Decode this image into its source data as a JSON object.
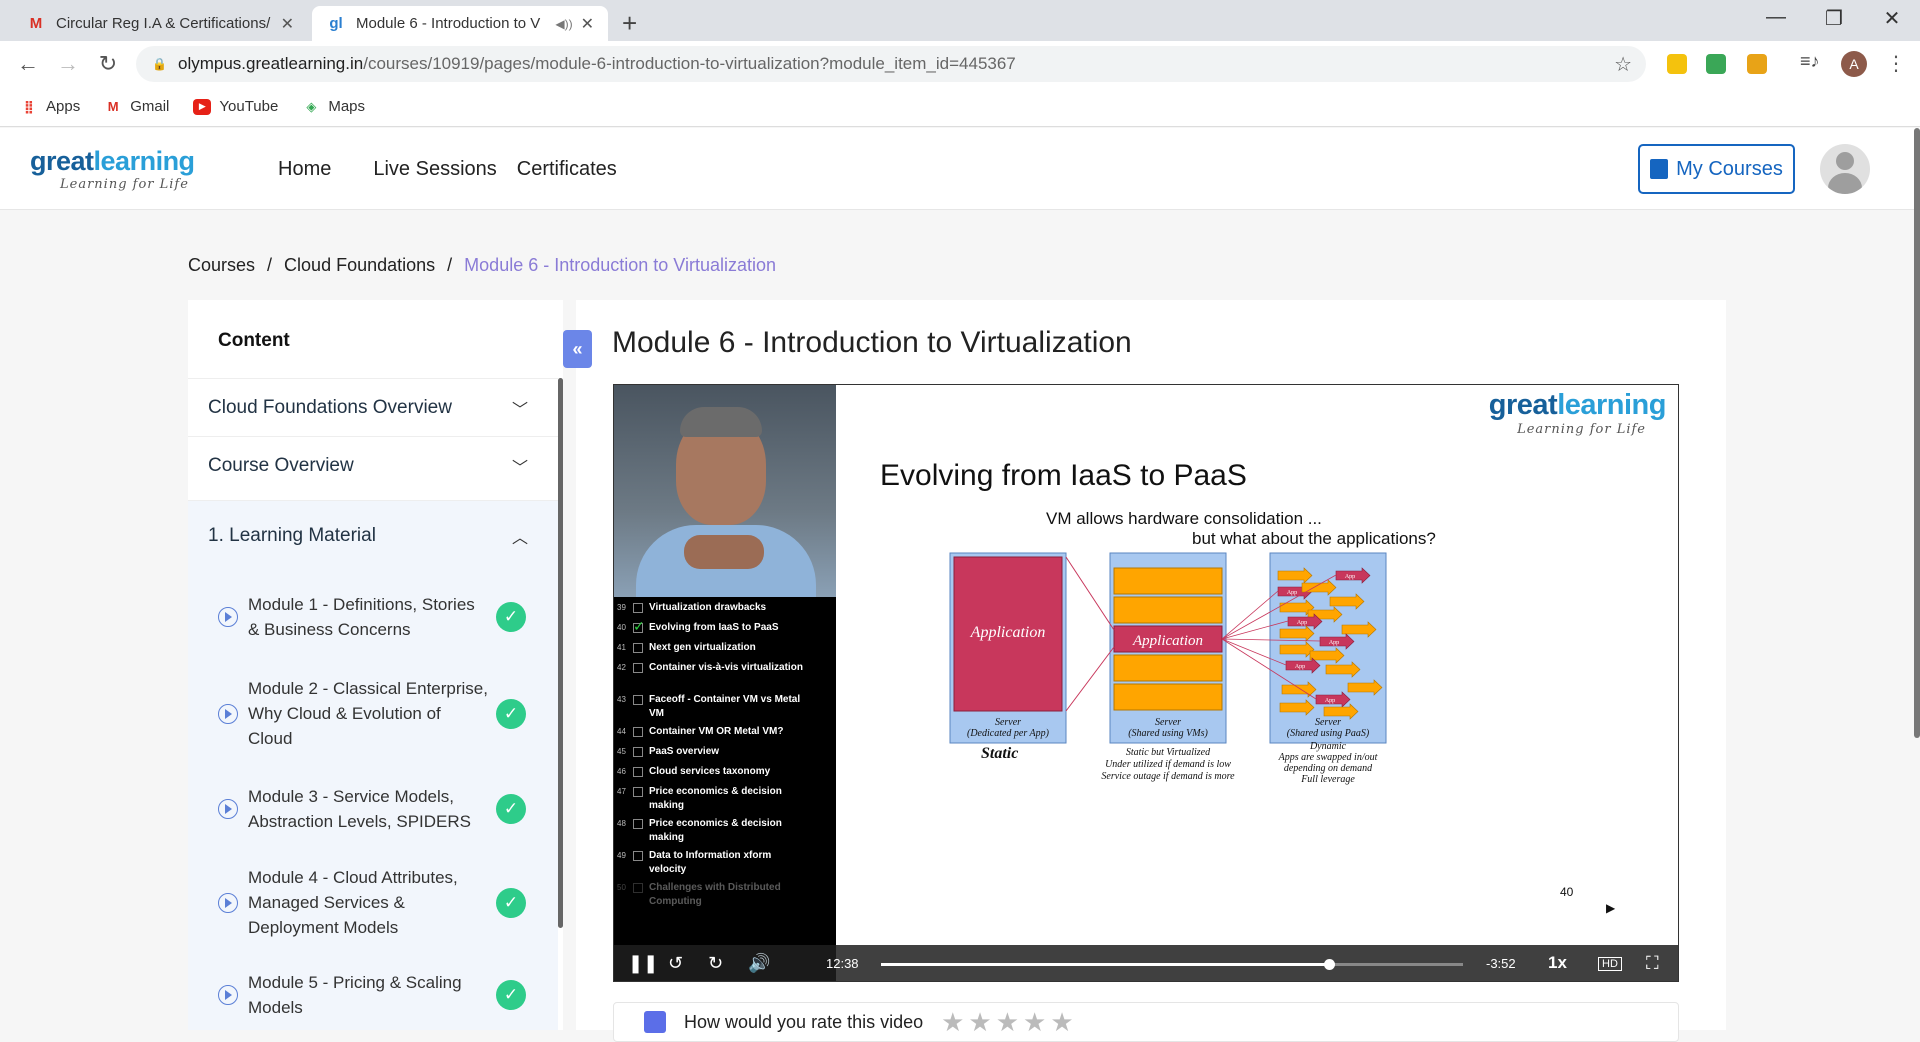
{
  "browser": {
    "tabs": [
      {
        "title": "Circular Reg I.A & Certifications/",
        "favicon": "gmail-icon"
      },
      {
        "title": "Module 6 - Introduction to V",
        "favicon": "greatlearning-icon"
      }
    ],
    "url_host": "olympus.greatlearning.in",
    "url_path": "/courses/10919/pages/module-6-introduction-to-virtualization?module_item_id=445367",
    "profile_initial": "A",
    "bookmarks": [
      {
        "label": "Apps",
        "icon": "apps-grid-icon"
      },
      {
        "label": "Gmail",
        "icon": "gmail-icon"
      },
      {
        "label": "YouTube",
        "icon": "youtube-icon"
      },
      {
        "label": "Maps",
        "icon": "maps-icon"
      }
    ]
  },
  "site": {
    "logo_brand_a": "great",
    "logo_brand_b": "learning",
    "logo_tagline": "Learning for Life",
    "nav": [
      "Home",
      "Live Sessions",
      "Certificates"
    ],
    "my_courses": "My Courses"
  },
  "breadcrumb": {
    "items": [
      "Courses",
      "Cloud Foundations"
    ],
    "separator": "/",
    "current": "Module 6 - Introduction to Virtualization"
  },
  "sidebar": {
    "heading": "Content",
    "sections": [
      {
        "label": "Cloud Foundations Overview",
        "expanded": false
      },
      {
        "label": "Course Overview",
        "expanded": false
      },
      {
        "label": "1. Learning Material",
        "expanded": true
      }
    ],
    "items": [
      {
        "label": "Module 1 - Definitions, Stories & Business Concerns",
        "completed": true
      },
      {
        "label": "Module 2 - Classical Enterprise, Why Cloud & Evolution of Cloud",
        "completed": true
      },
      {
        "label": "Module 3 - Service Models, Abstraction Levels, SPIDERS",
        "completed": true
      },
      {
        "label": "Module 4 - Cloud Attributes, Managed Services & Deployment Models",
        "completed": true
      },
      {
        "label": "Module 5 - Pricing & Scaling Models",
        "completed": true
      }
    ],
    "collapse_label": "«"
  },
  "page": {
    "title": "Module 6 - Introduction to Virtualization"
  },
  "video": {
    "toc": [
      {
        "n": "39",
        "label": "Virtualization drawbacks",
        "checked": false
      },
      {
        "n": "40",
        "label": "Evolving from IaaS to PaaS",
        "checked": true
      },
      {
        "n": "41",
        "label": "Next gen virtualization",
        "checked": false
      },
      {
        "n": "42",
        "label": "Container vis-à-vis virtualization",
        "checked": false
      },
      {
        "n": "43",
        "label": "Faceoff - Container VM vs Metal VM",
        "checked": false
      },
      {
        "n": "44",
        "label": "Container VM OR Metal VM?",
        "checked": false
      },
      {
        "n": "45",
        "label": "PaaS overview",
        "checked": false
      },
      {
        "n": "46",
        "label": "Cloud services taxonomy",
        "checked": false
      },
      {
        "n": "47",
        "label": "Price economics & decision making",
        "checked": false
      },
      {
        "n": "48",
        "label": "Price economics & decision making",
        "checked": false
      },
      {
        "n": "49",
        "label": "Data to Information xform velocity",
        "checked": false
      },
      {
        "n": "50",
        "label": "Challenges with Distributed Computing",
        "checked": false
      }
    ],
    "slide": {
      "logo_a": "great",
      "logo_b": "learning",
      "logo_tagline": "Learning for Life",
      "title": "Evolving from IaaS to PaaS",
      "subtitle1": "VM allows hardware consolidation ...",
      "subtitle2": "but what about the applications?",
      "app_label": "Application",
      "small_app_label": "App",
      "servers": [
        {
          "caption": "Server",
          "caption2": "(Dedicated per App)",
          "label": "Static",
          "desc": []
        },
        {
          "caption": "Server",
          "caption2": "(Shared using VMs)",
          "label": "",
          "desc": [
            "Static but Virtualized",
            "Under utilized if demand is low",
            "Service outage if demand is more"
          ]
        },
        {
          "caption": "Server",
          "caption2": "(Shared using PaaS)",
          "label": "",
          "desc": [
            "Dynamic",
            "Apps are swapped in/out",
            "depending on demand",
            "Full leverage"
          ]
        }
      ],
      "slide_number": "40",
      "colors": {
        "app": "#c8375c",
        "vm": "#ffa500",
        "server_bg": "#a8c8f0"
      }
    },
    "controls": {
      "elapsed": "12:38",
      "remaining": "-3:52",
      "speed": "1x",
      "progress": 0.77
    }
  },
  "rating": {
    "question": "How would you rate this video",
    "stars": "★★★★★"
  }
}
